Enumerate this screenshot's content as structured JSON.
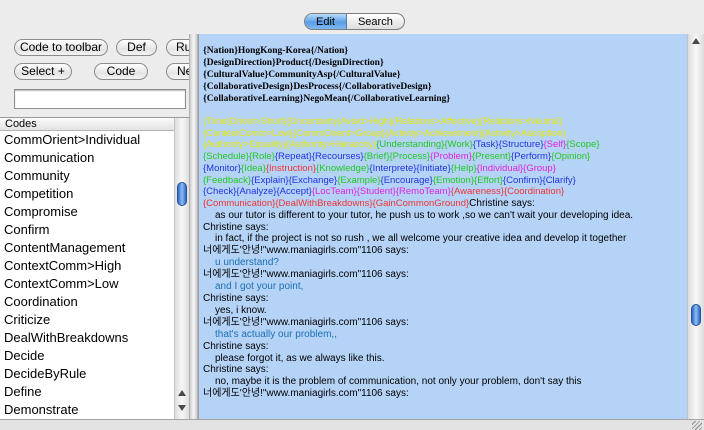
{
  "tabs": [
    {
      "label": "Edit",
      "selected": true
    },
    {
      "label": "Search",
      "selected": false
    }
  ],
  "toolbar": {
    "code_to_toolbar": "Code to toolbar",
    "def": "Def",
    "ru_partial": "Ru",
    "select_plus": "Select +",
    "code": "Code",
    "ne_partial": "Ne"
  },
  "code_filter": {
    "value": ""
  },
  "codes": {
    "header": "Codes",
    "items": [
      "CommOrient>Individual",
      "Communication",
      "Community",
      "Competition",
      "Compromise",
      "Confirm",
      "ContentManagement",
      "ContextComm>High",
      "ContextComm>Low",
      "Coordination",
      "Criticize",
      "DealWithBreakdowns",
      "Decide",
      "DecideByRule",
      "Define",
      "Demonstrate"
    ]
  },
  "doc": {
    "header_lines": [
      "{Nation}HongKong-Korea{/Nation}",
      "{DesignDirection}Product{/DesignDirection}",
      "{CulturalValue}CommunityAsp{/CulturalValue}",
      "{CollaborativeDesign}DesProcess{/CollaborativeDesign}",
      "{CollaborativeLearning}NegoMean{/CollaborativeLearning}"
    ],
    "tag_lines": [
      [
        {
          "t": "{Time|Orient>Short}",
          "c": "#e8e800"
        },
        {
          "t": "{Uncertainty|Avoid>High}",
          "c": "#e8e800"
        },
        {
          "t": "{Relations>Affective}",
          "c": "#e8e800"
        },
        {
          "t": "{Relations>Neutral}",
          "c": "#e8e800"
        }
      ],
      [
        {
          "t": "{ContextComm>Low}",
          "c": "#e8e800"
        },
        {
          "t": "{CommOrient>Group}",
          "c": "#e8e800"
        },
        {
          "t": "{Activity>Achievement}",
          "c": "#e8e800"
        },
        {
          "t": "{Activity>Ascription}",
          "c": "#e8e800"
        }
      ],
      [
        {
          "t": "{Authority>Equality}",
          "c": "#e8e800"
        },
        {
          "t": "{Authority>Hierarchy}",
          "c": "#e8e800"
        },
        {
          "t": "{Understanding}",
          "c": "#22c722"
        },
        {
          "t": "{Work}",
          "c": "#22c722"
        },
        {
          "t": "{Task}",
          "c": "#2233dd"
        },
        {
          "t": "{Structure}",
          "c": "#2233dd"
        },
        {
          "t": "{Self}",
          "c": "#e022e0"
        },
        {
          "t": "{Scope}",
          "c": "#22c722"
        }
      ],
      [
        {
          "t": "{Schedule}",
          "c": "#22c722"
        },
        {
          "t": "{Role}",
          "c": "#22c722"
        },
        {
          "t": "{Repeat}",
          "c": "#2233dd"
        },
        {
          "t": "{Recourses}",
          "c": "#2233dd"
        },
        {
          "t": "{Brief}",
          "c": "#22c722"
        },
        {
          "t": "{Process}",
          "c": "#22c722"
        },
        {
          "t": "{Problem}",
          "c": "#e022e0"
        },
        {
          "t": "{Present}",
          "c": "#22c722"
        },
        {
          "t": "{Perform}",
          "c": "#2233dd"
        },
        {
          "t": "{Opinion}",
          "c": "#22c722"
        }
      ],
      [
        {
          "t": "{Monitor}",
          "c": "#2233dd"
        },
        {
          "t": "{Idea}",
          "c": "#22c722"
        },
        {
          "t": "{Instruction}",
          "c": "#ee3333"
        },
        {
          "t": "{Knowledge}",
          "c": "#22c722"
        },
        {
          "t": "{Interprete}",
          "c": "#2233dd"
        },
        {
          "t": "{Initiate}",
          "c": "#2233dd"
        },
        {
          "t": "{Help}",
          "c": "#22c722"
        },
        {
          "t": "{Individual}",
          "c": "#e022e0"
        },
        {
          "t": "{Group}",
          "c": "#e022e0"
        }
      ],
      [
        {
          "t": "{Feedback}",
          "c": "#22c722"
        },
        {
          "t": "{Explain}",
          "c": "#2233dd"
        },
        {
          "t": "{Exchange}",
          "c": "#2233dd"
        },
        {
          "t": "{Example}",
          "c": "#22c722"
        },
        {
          "t": "{Encourage}",
          "c": "#2233dd"
        },
        {
          "t": "{Emotion}",
          "c": "#22c722"
        },
        {
          "t": "{Effort}",
          "c": "#22c722"
        },
        {
          "t": "{Confirm}",
          "c": "#2233dd"
        },
        {
          "t": "{Clarify}",
          "c": "#2233dd"
        }
      ],
      [
        {
          "t": "{Check}",
          "c": "#2233dd"
        },
        {
          "t": "{Analyze}",
          "c": "#2233dd"
        },
        {
          "t": "{Accept}",
          "c": "#2233dd"
        },
        {
          "t": "{LocTeam}",
          "c": "#e022e0"
        },
        {
          "t": "{Student}",
          "c": "#e022e0"
        },
        {
          "t": "{RemoTeam}",
          "c": "#e022e0"
        },
        {
          "t": "{Awareness}",
          "c": "#ee3333"
        },
        {
          "t": "{Coordination}",
          "c": "#ee3333"
        }
      ]
    ],
    "last_tag_line": [
      {
        "t": "{Communication}",
        "c": "#ee3333"
      },
      {
        "t": "{DealWithBreakdowns}",
        "c": "#ee3333"
      },
      {
        "t": "{GainCommonGround}",
        "c": "#ee3333"
      }
    ],
    "first_speaker": "Christine  says:",
    "messages": [
      {
        "kind": "msg",
        "text": "as our tutor is different to your tutor, he push us to work ,so we can't wait your developing idea.",
        "color": "#000000"
      },
      {
        "kind": "speaker",
        "text": "Christine  says:"
      },
      {
        "kind": "msg",
        "text": "in fact, if the project is not so rush , we all welcome your creative idea and develop it together",
        "color": "#000000"
      },
      {
        "kind": "speaker",
        "text": "너에게도'안녕!\"www.maniagirls.com\"1106 says:"
      },
      {
        "kind": "msg",
        "text": "u understand?",
        "color": "#1a6fb4"
      },
      {
        "kind": "speaker",
        "text": "너에게도'안녕!\"www.maniagirls.com\"1106 says:"
      },
      {
        "kind": "msg",
        "text": "and I got your point,",
        "color": "#1a6fb4"
      },
      {
        "kind": "speaker",
        "text": "Christine  says:"
      },
      {
        "kind": "msg",
        "text": "yes, i know.",
        "color": "#000000"
      },
      {
        "kind": "speaker",
        "text": "너에게도'안녕!\"www.maniagirls.com\"1106 says:"
      },
      {
        "kind": "msg",
        "text": "that's actually our problem,,",
        "color": "#1a6fb4"
      },
      {
        "kind": "speaker",
        "text": "Christine  says:"
      },
      {
        "kind": "msg",
        "text": "please forgot it, as we always like this.",
        "color": "#000000"
      },
      {
        "kind": "speaker",
        "text": "Christine  says:"
      },
      {
        "kind": "msg",
        "text": "no, maybe it is the problem of communication, not only your problem, don't say this",
        "color": "#000000"
      },
      {
        "kind": "speaker",
        "text": "너에게도'안녕!\"www.maniagirls.com\"1106 says:"
      }
    ]
  }
}
